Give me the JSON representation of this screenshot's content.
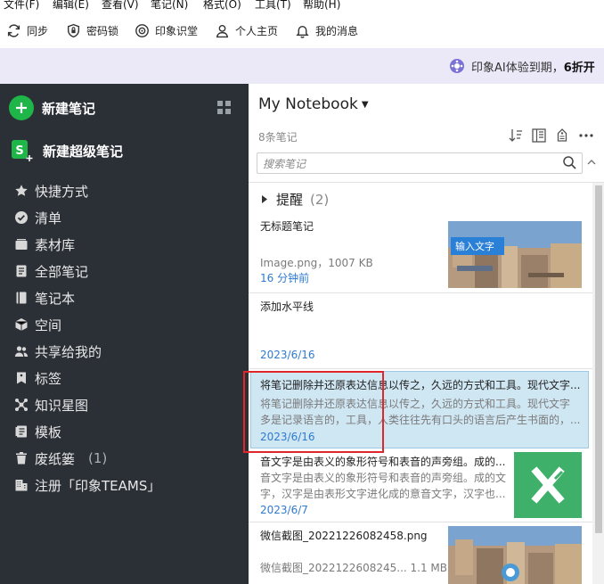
{
  "menu": [
    "文件(F)",
    "编辑(E)",
    "查看(V)",
    "笔记(N)",
    "格式(O)",
    "工具(T)",
    "帮助(H)"
  ],
  "toolbar": {
    "sync": "同步",
    "lock": "密码锁",
    "classroom": "印象识堂",
    "profile": "个人主页",
    "messages": "我的消息"
  },
  "banner": {
    "text": "印象AI体验到期，",
    "bold": "6折开"
  },
  "sidebar": {
    "new_note": "新建笔记",
    "new_super_note": "新建超级笔记",
    "items": [
      {
        "icon": "star-icon",
        "label": "快捷方式"
      },
      {
        "icon": "check-circle-icon",
        "label": "清单"
      },
      {
        "icon": "material-box-icon",
        "label": "素材库"
      },
      {
        "icon": "notes-icon",
        "label": "全部笔记"
      },
      {
        "icon": "notebook-icon",
        "label": "笔记本"
      },
      {
        "icon": "cube-icon",
        "label": "空间"
      },
      {
        "icon": "shared-users-icon",
        "label": "共享给我的"
      },
      {
        "icon": "tag-icon",
        "label": "标签"
      },
      {
        "icon": "knowledge-graph-icon",
        "label": "知识星图"
      },
      {
        "icon": "template-icon",
        "label": "模板"
      },
      {
        "icon": "trash-icon",
        "label": "废纸篓",
        "count": "(1)"
      },
      {
        "icon": "building-icon",
        "label": "注册「印象TEAMS」"
      }
    ]
  },
  "panel": {
    "notebook_title": "My Notebook",
    "note_count": "8条笔记",
    "search_placeholder": "搜索笔记",
    "reminder_label": "提醒",
    "reminder_count": "(2)",
    "notes": [
      {
        "title": "无标题笔记",
        "snippet": "Image.png，1007 KB",
        "date": "16 分钟前",
        "thumb_text": "输入文字"
      },
      {
        "title": "添加水平线",
        "snippet": "",
        "date": "2023/6/16"
      },
      {
        "title": "将笔记删除并还原表达信息以传之，久远的方式和工具。现代文字...",
        "snippet1": "将笔记删除并还原表达信息以传之，久远的方式和工具。现代文字",
        "snippet2": "多是记录语言的，工具，人类往往先有口头的语言后产生书面的，...",
        "date": "2023/6/16"
      },
      {
        "title": "音文字是由表义的象形符号和表音的声旁组。成的...",
        "snippet1": "音文字是由表义的象形符号和表音的声旁组。成的文",
        "snippet2": "字，汉字是由表形文字进化成的意音文字，汉字也...",
        "date": "2023/6/7"
      },
      {
        "title": "微信截图_20221226082458.png",
        "snippet": "微信截图_2022122608245...  1.1 MB",
        "date": ""
      }
    ]
  },
  "colors": {
    "sidebar_bg": "#2b2f36",
    "accent_green": "#1eb649",
    "selected_bg": "#cfe6f3",
    "date_blue": "#2f7bd0",
    "annotation_red": "#e0262a"
  }
}
